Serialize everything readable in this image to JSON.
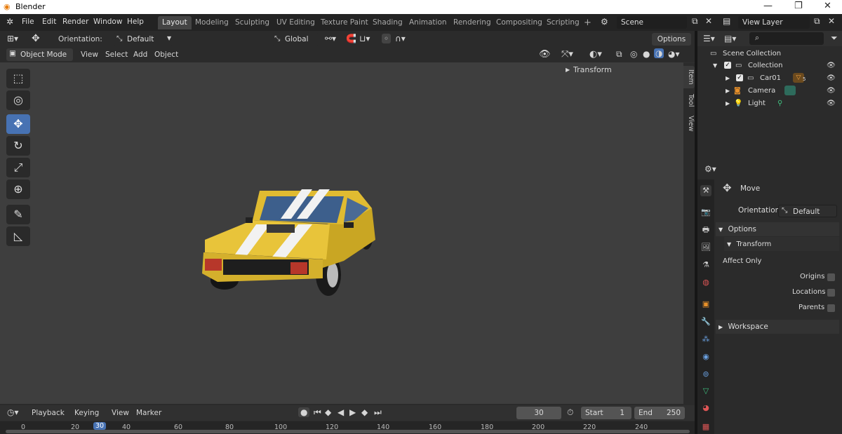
{
  "window": {
    "title": "Blender",
    "minimize": "—",
    "restore": "❐",
    "close": "✕"
  },
  "menus": [
    "File",
    "Edit",
    "Render",
    "Window",
    "Help"
  ],
  "workspace_tabs": [
    "Layout",
    "Modeling",
    "Sculpting",
    "UV Editing",
    "Texture Paint",
    "Shading",
    "Animation",
    "Rendering",
    "Compositing",
    "Scripting"
  ],
  "active_tab": "Layout",
  "add_tab": "+",
  "scene": {
    "name": "Scene"
  },
  "view_layer": {
    "name": "View Layer"
  },
  "viewport": {
    "orientation_label": "Orientation:",
    "orientation_value": "Default",
    "transform_space": "Global",
    "options_label": "Options",
    "mode": "Object Mode",
    "header_menus": [
      "View",
      "Select",
      "Add",
      "Object"
    ],
    "npanel_section": "Transform",
    "npanel_tabs": [
      "Item",
      "Tool",
      "View"
    ]
  },
  "toolbar": [
    {
      "name": "select-box-tool",
      "glyph": "⬚",
      "active": false
    },
    {
      "name": "cursor-tool",
      "glyph": "◎",
      "active": false
    },
    {
      "name": "move-tool",
      "glyph": "✥",
      "active": true
    },
    {
      "name": "rotate-tool",
      "glyph": "↻",
      "active": false
    },
    {
      "name": "scale-tool",
      "glyph": "⤢",
      "active": false
    },
    {
      "name": "transform-tool",
      "glyph": "⊕",
      "active": false
    },
    {
      "name": "annotate-tool",
      "glyph": "✎",
      "active": false
    },
    {
      "name": "measure-tool",
      "glyph": "📐",
      "active": false
    }
  ],
  "outliner": {
    "search_placeholder": "",
    "root": "Scene Collection",
    "items": [
      {
        "label": "Collection",
        "indent": 0,
        "check": true
      },
      {
        "label": "Car01",
        "indent": 1,
        "check": true,
        "badge": "5"
      },
      {
        "label": "Camera",
        "indent": 1,
        "check": false
      },
      {
        "label": "Light",
        "indent": 1,
        "check": false
      }
    ]
  },
  "properties": {
    "tool_name": "Move",
    "orientation_label": "Orientation",
    "orientation_value": "Default",
    "options_section": "Options",
    "transform_sub": "Transform",
    "affect_only": "Affect Only",
    "checkboxes": [
      "Origins",
      "Locations",
      "Parents"
    ],
    "workspace_section": "Workspace"
  },
  "timeline": {
    "menus": [
      "Playback",
      "Keying",
      "View",
      "Marker"
    ],
    "current_frame": "30",
    "start_label": "Start",
    "start": "1",
    "end_label": "End",
    "end": "250",
    "ticks": [
      "0",
      "20",
      "30",
      "40",
      "60",
      "80",
      "100",
      "120",
      "140",
      "160",
      "180",
      "200",
      "220",
      "240"
    ]
  },
  "colors": {
    "accent": "#4772b3",
    "car_body": "#e8c43a",
    "window": "#3d5f8c"
  }
}
